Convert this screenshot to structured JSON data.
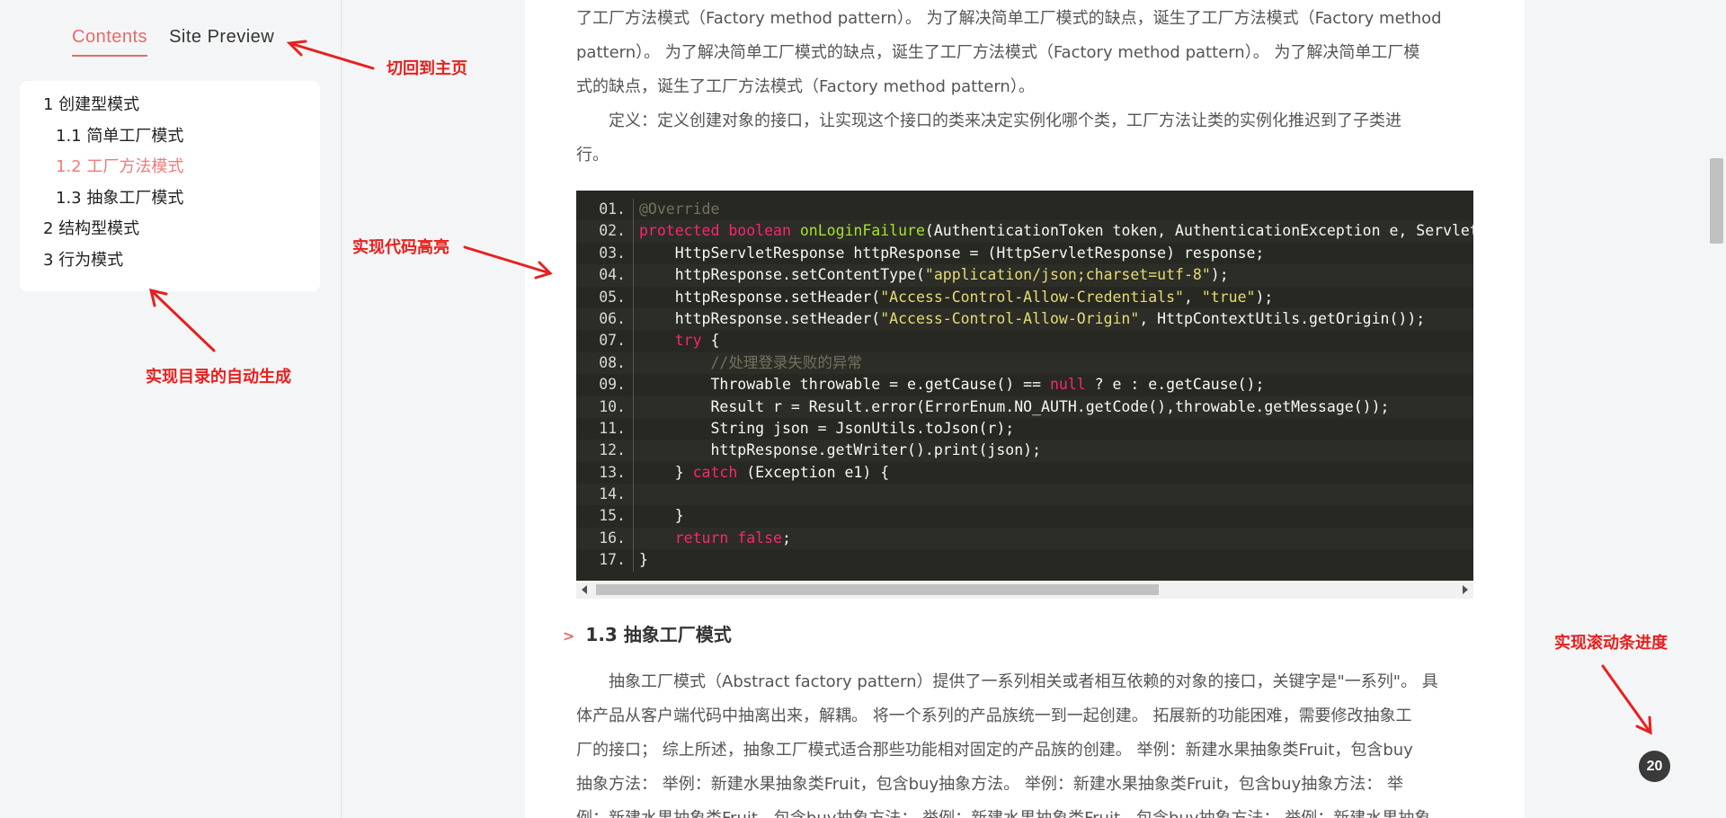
{
  "tabs": {
    "contents": "Contents",
    "site_preview": "Site Preview"
  },
  "toc": [
    {
      "label": "1 创建型模式",
      "level": 1
    },
    {
      "label": "1.1 简单工厂模式",
      "level": 2
    },
    {
      "label": "1.2 工厂方法模式",
      "level": 2,
      "active": true
    },
    {
      "label": "1.3 抽象工厂模式",
      "level": 2
    },
    {
      "label": "2 结构型模式",
      "level": 1
    },
    {
      "label": "3 行为模式",
      "level": 1
    }
  ],
  "para1": [
    "了工厂方法模式（Factory method pattern）。 为了解决简单工厂模式的缺点，诞生了工厂方法模式（Factory method",
    "pattern）。 为了解决简单工厂模式的缺点，诞生了工厂方法模式（Factory method pattern）。 为了解决简单工厂模",
    "式的缺点，诞生了工厂方法模式（Factory method pattern）。",
    "　　定义：定义创建对象的接口，让实现这个接口的类来决定实例化哪个类，工厂方法让类的实例化推迟到了子类进",
    "行。"
  ],
  "code": [
    {
      "n": "01.",
      "html": "<span class='cm'>@Override</span>"
    },
    {
      "n": "02.",
      "html": "<span class='kw'>protected boolean</span> <span class='fn'>onLoginFailure</span>(AuthenticationToken token, AuthenticationException e, ServletRequest request, ServletResponse response) {"
    },
    {
      "n": "03.",
      "html": "    HttpServletResponse httpResponse = (HttpServletResponse) response;"
    },
    {
      "n": "04.",
      "html": "    httpResponse.setContentType(<span class='str'>\"application/json;charset=utf-8\"</span>);"
    },
    {
      "n": "05.",
      "html": "    httpResponse.setHeader(<span class='str'>\"Access-Control-Allow-Credentials\"</span>, <span class='str'>\"true\"</span>);"
    },
    {
      "n": "06.",
      "html": "    httpResponse.setHeader(<span class='str'>\"Access-Control-Allow-Origin\"</span>, HttpContextUtils.getOrigin());"
    },
    {
      "n": "07.",
      "html": "    <span class='kw'>try</span> {"
    },
    {
      "n": "08.",
      "html": "        <span class='cm'>//处理登录失败的异常</span>"
    },
    {
      "n": "09.",
      "html": "        Throwable throwable = e.getCause() == <span class='kw'>null</span> ? e : e.getCause();"
    },
    {
      "n": "10.",
      "html": "        Result r = Result.error(ErrorEnum.NO_AUTH.getCode(),throwable.getMessage());"
    },
    {
      "n": "11.",
      "html": "        String json = JsonUtils.toJson(r);"
    },
    {
      "n": "12.",
      "html": "        httpResponse.getWriter().print(json);"
    },
    {
      "n": "13.",
      "html": "    } <span class='kw'>catch</span> (Exception e1) {"
    },
    {
      "n": "14.",
      "html": ""
    },
    {
      "n": "15.",
      "html": "    }"
    },
    {
      "n": "16.",
      "html": "    <span class='kw'>return false</span>;"
    },
    {
      "n": "17.",
      "html": "}"
    }
  ],
  "section_heading": {
    "chevron": ">",
    "title": "1.3 抽象工厂模式"
  },
  "para2": [
    "　　抽象工厂模式（Abstract factory pattern）提供了一系列相关或者相互依赖的对象的接口，关键字是\"一系列\"。 具",
    "体产品从客户端代码中抽离出来，解耦。 将一个系列的产品族统一到一起创建。 拓展新的功能困难，需要修改抽象工",
    "厂的接口； 综上所述，抽象工厂模式适合那些功能相对固定的产品族的创建。 举例：新建水果抽象类Fruit，包含buy",
    "抽象方法： 举例：新建水果抽象类Fruit，包含buy抽象方法。 举例：新建水果抽象类Fruit，包含buy抽象方法： 举",
    "例：新建水果抽象类Fruit，包含buy抽象方法： 举例：新建水果抽象类Fruit，包含buy抽象方法： 举例：新建水果抽象"
  ],
  "annotations": {
    "home": "切回到主页",
    "highlight": "实现代码高亮",
    "toc": "实现目录的自动生成",
    "scroll": "实现滚动条进度"
  },
  "progress": "20",
  "colors": {
    "accent": "#e86a6a",
    "annotation": "#e8201e",
    "code_bg": "#272822"
  }
}
